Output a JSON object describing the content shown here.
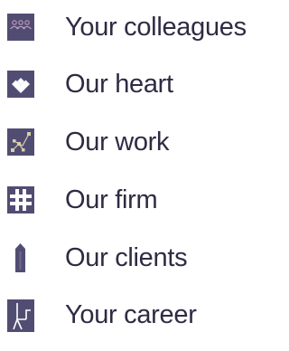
{
  "nav": {
    "items": [
      {
        "label": "Your colleagues",
        "icon": "people-group-icon"
      },
      {
        "label": "Our heart",
        "icon": "heart-icon"
      },
      {
        "label": "Our work",
        "icon": "network-nodes-icon"
      },
      {
        "label": "Our firm",
        "icon": "hash-grid-icon"
      },
      {
        "label": "Our clients",
        "icon": "building-tower-icon"
      },
      {
        "label": "Your career",
        "icon": "career-path-icon"
      }
    ]
  },
  "colors": {
    "icon_bg": "#514d72",
    "icon_fg": "#ffffff",
    "text": "#2e2b43"
  }
}
